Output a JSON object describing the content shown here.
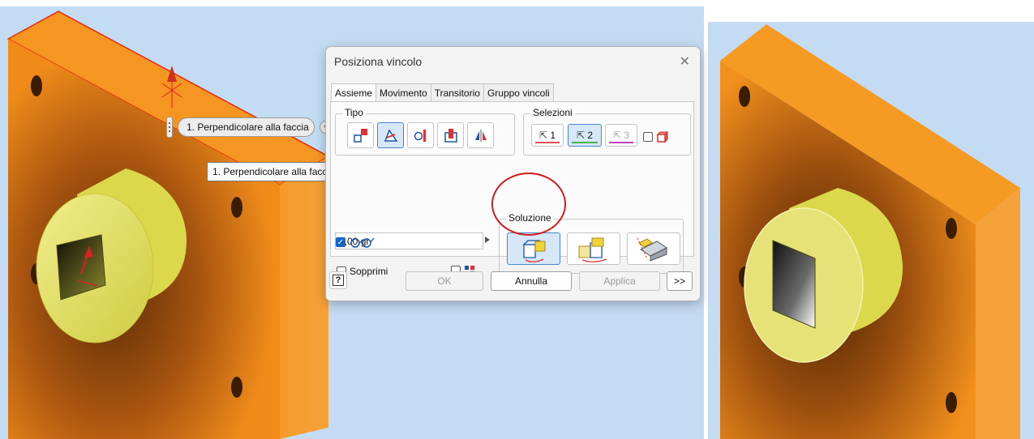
{
  "dialog": {
    "title": "Posiziona vincolo",
    "close_glyph": "✕",
    "tabs": [
      {
        "label": "Assieme",
        "active": true
      },
      {
        "label": "Movimento",
        "active": false
      },
      {
        "label": "Transitorio",
        "active": false
      },
      {
        "label": "Gruppo vincoli",
        "active": false
      }
    ],
    "tipo_label": "Tipo",
    "type_buttons": [
      "mate-constraint-icon",
      "angle-constraint-icon",
      "tangent-constraint-icon",
      "insert-constraint-icon",
      "symmetry-constraint-icon"
    ],
    "selezioni_label": "Selezioni",
    "selections": [
      {
        "label": "1",
        "underline_color": "#e05050",
        "selected": false
      },
      {
        "label": "2",
        "underline_color": "#4caf50",
        "selected": true
      },
      {
        "label": "3",
        "underline_color": "#c040c0",
        "selected": false
      }
    ],
    "soluzione_label": "Soluzione",
    "angle_value": "0,00 gr",
    "sopprimi_label": "Sopprimi",
    "sopprimi_checked": false,
    "preview_checked": true,
    "footer": {
      "ok": "OK",
      "cancel": "Annulla",
      "apply": "Applica",
      "more": ">>",
      "help_glyph": "?"
    }
  },
  "mini_toolbar": {
    "label": "1. Perpendicolare alla faccia",
    "dropdown_glyph": "▼"
  },
  "tooltip": {
    "text": "1. Perpendicolare alla faccia"
  },
  "colors": {
    "viewport_bg": "#c4dcf3",
    "part_orange": "#f59a22",
    "part_yellow": "#e8e56a",
    "highlight_red": "#d21d1d",
    "selected_blue": "#d6e7f7"
  }
}
